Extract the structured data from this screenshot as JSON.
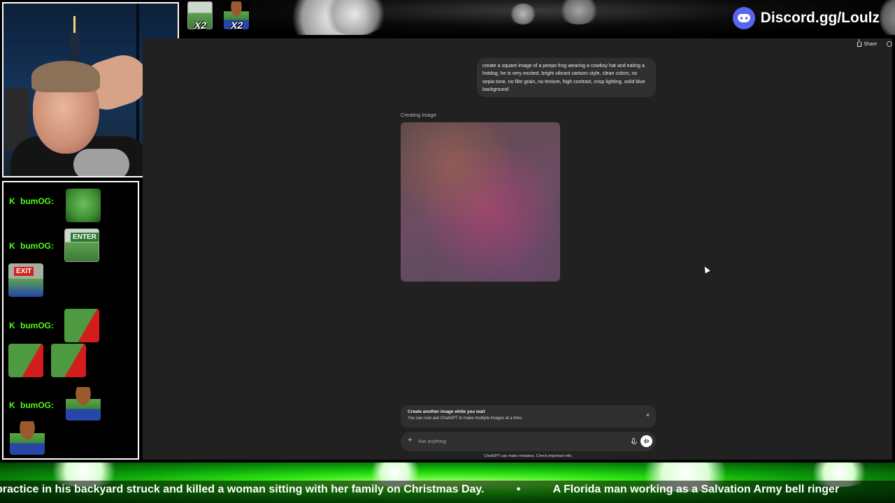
{
  "overlay": {
    "discord_link": "Discord.gg/Loulz",
    "emote_counters": [
      {
        "icon": "enter-frog-emote-icon",
        "count": "X2"
      },
      {
        "icon": "cowboy-frog-emote-icon",
        "count": "X2"
      }
    ]
  },
  "chat": {
    "messages": [
      {
        "user": "bumOG:",
        "emotes": [
          "frog-emote-icon"
        ]
      },
      {
        "user": "bumOG:",
        "emotes": [
          "enter-sign-emote-icon",
          "exit-sign-emote-icon"
        ],
        "enter_label": "ENTER",
        "exit_label": "EXIT"
      },
      {
        "user": "bumOG:",
        "emotes": [
          "red-flag-frog-emote-icon",
          "red-flag-frog-emote-icon",
          "red-flag-frog-emote-icon"
        ]
      },
      {
        "user": "bumOG:",
        "emotes": [
          "cowboy-frog-emote-icon",
          "cowboy-frog-emote-icon"
        ]
      }
    ]
  },
  "chatgpt": {
    "share_label": "Share",
    "user_prompt": "create a square image of a peepo frog wearing a cowboy hat and eating a hotdog, he is very excited, bright vibrant cartoon style, clean colors, no sepia tone, no film grain, no texture, high contrast, crisp lighting, solid blue background",
    "status_label": "Creating image",
    "notice_title": "Create another image while you wait",
    "notice_text": "You can now ask ChatGPT to make multiple images at a time.",
    "notice_close": "×",
    "composer_placeholder": "Ask anything",
    "disclaimer": "ChatGPT can make mistakes. Check important info."
  },
  "ticker": {
    "headline_1": "practice in his backyard struck and killed a woman sitting with her family on Christmas Day.",
    "separator": "•",
    "headline_2": "A Florida man working as a Salvation Army bell ringer"
  },
  "colors": {
    "chatgpt_bg": "#212121",
    "bubble_bg": "#303030",
    "kick_green": "#53fc18",
    "discord_blurple": "#5865f2"
  }
}
